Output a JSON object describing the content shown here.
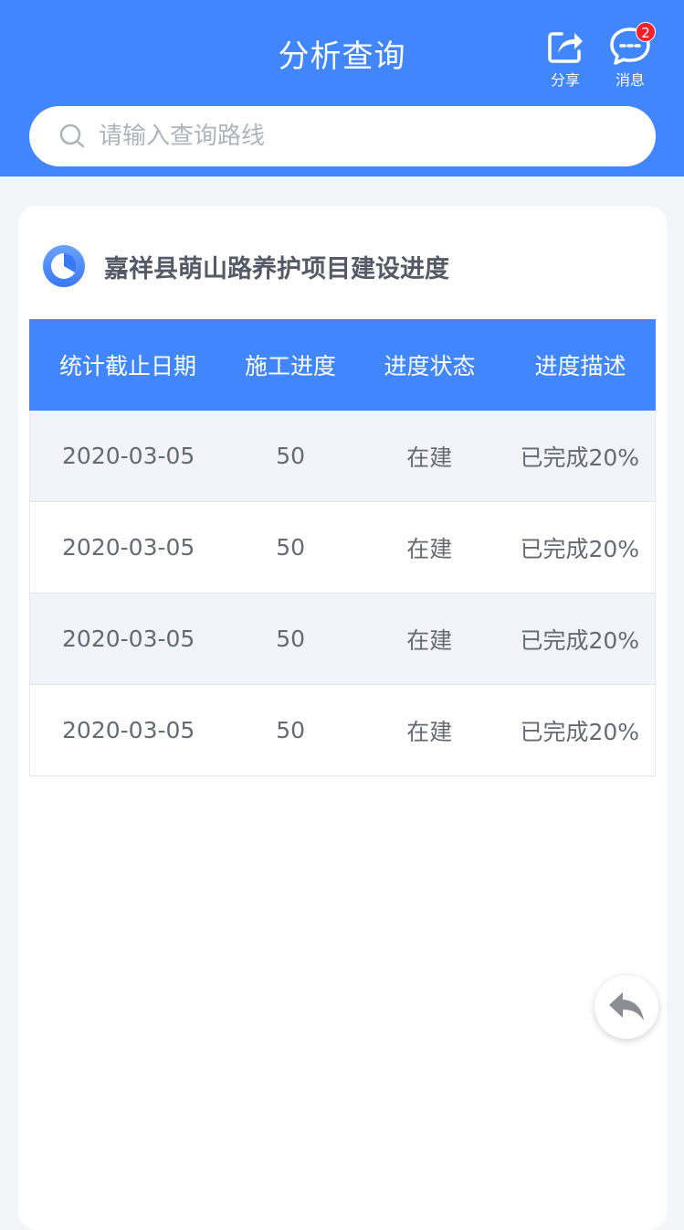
{
  "header": {
    "title": "分析查询",
    "share_label": "分享",
    "message_label": "消息",
    "message_badge": "2"
  },
  "search": {
    "placeholder": "请输入查询路线"
  },
  "card": {
    "title": "嘉祥县萌山路养护项目建设进度",
    "table": {
      "headers": [
        "统计截止日期",
        "施工进度",
        "进度状态",
        "进度描述"
      ],
      "rows": [
        [
          "2020-03-05",
          "50",
          "在建",
          "已完成20%"
        ],
        [
          "2020-03-05",
          "50",
          "在建",
          "已完成20%"
        ],
        [
          "2020-03-05",
          "50",
          "在建",
          "已完成20%"
        ],
        [
          "2020-03-05",
          "50",
          "在建",
          "已完成20%"
        ]
      ]
    }
  },
  "colors": {
    "primary": "#4186fc",
    "background": "#f4f5f9",
    "badge": "#f5222d",
    "row_alt": "#f3f4f9"
  },
  "icons": {
    "share": "share-icon",
    "message": "chat-bubble-icon",
    "search": "search-icon",
    "card": "clock-icon",
    "back": "reply-arrow-icon"
  }
}
